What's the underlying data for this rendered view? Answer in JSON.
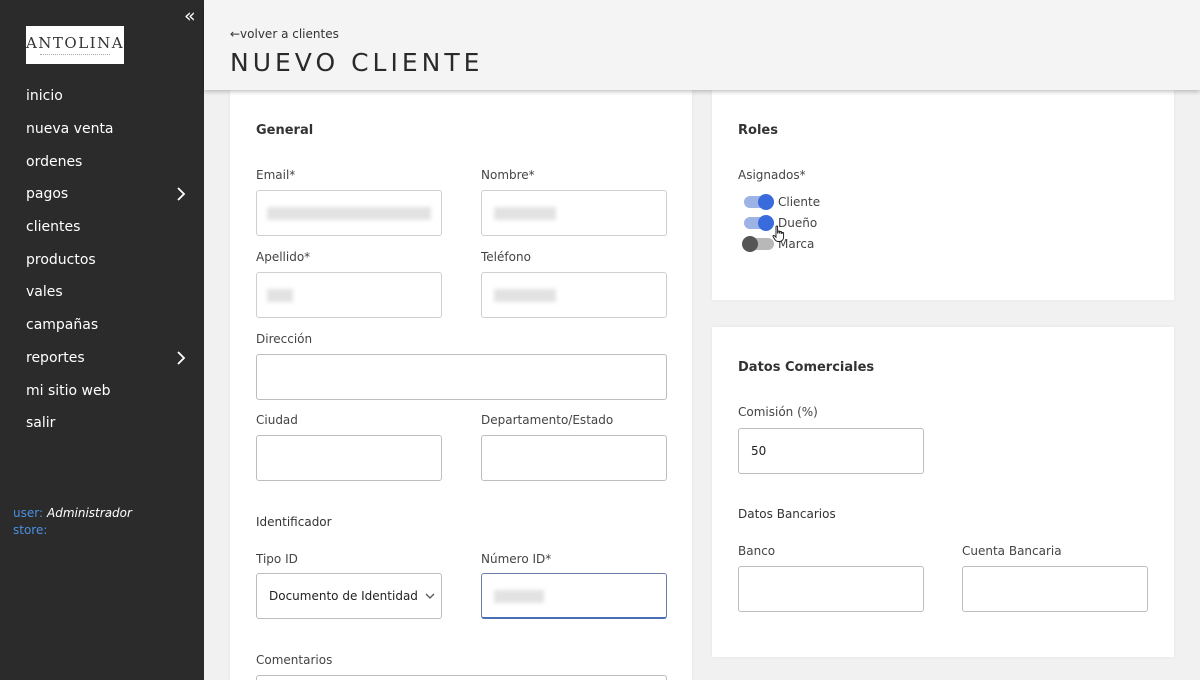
{
  "sidebar": {
    "logo": "ANTOLINA",
    "items": [
      {
        "label": "inicio"
      },
      {
        "label": "nueva venta"
      },
      {
        "label": "ordenes"
      },
      {
        "label": "pagos"
      },
      {
        "label": "clientes"
      },
      {
        "label": "productos"
      },
      {
        "label": "vales"
      },
      {
        "label": "campañas"
      },
      {
        "label": "reportes"
      },
      {
        "label": "mi sitio web"
      },
      {
        "label": "salir"
      }
    ],
    "user_label": "user:",
    "user_value": "Administrador",
    "store_label": "store:",
    "collapse_glyph": "«"
  },
  "header": {
    "back_link": "←volver a clientes",
    "title": "NUEVO CLIENTE"
  },
  "general": {
    "title": "General",
    "email_label": "Email*",
    "nombre_label": "Nombre*",
    "apellido_label": "Apellido*",
    "telefono_label": "Teléfono",
    "direccion_label": "Dirección",
    "ciudad_label": "Ciudad",
    "departamento_label": "Departamento/Estado",
    "identificador_title": "Identificador",
    "tipo_id_label": "Tipo ID",
    "tipo_id_value": "Documento de Identidad",
    "numero_id_label": "Número ID*",
    "comentarios_label": "Comentarios"
  },
  "roles": {
    "title": "Roles",
    "asignados_label": "Asignados*",
    "items": [
      {
        "label": "Cliente",
        "on": true
      },
      {
        "label": "Dueño",
        "on": true
      },
      {
        "label": "Marca",
        "on": false
      }
    ]
  },
  "datos": {
    "title": "Datos Comerciales",
    "comision_label": "Comisión (%)",
    "comision_value": "50",
    "bancarios_title": "Datos Bancarios",
    "banco_label": "Banco",
    "cuenta_label": "Cuenta Bancaria"
  },
  "colors": {
    "sidebar_bg": "#2b2b2b",
    "accent": "#3a6bdc",
    "user_label": "#4a90e2"
  }
}
